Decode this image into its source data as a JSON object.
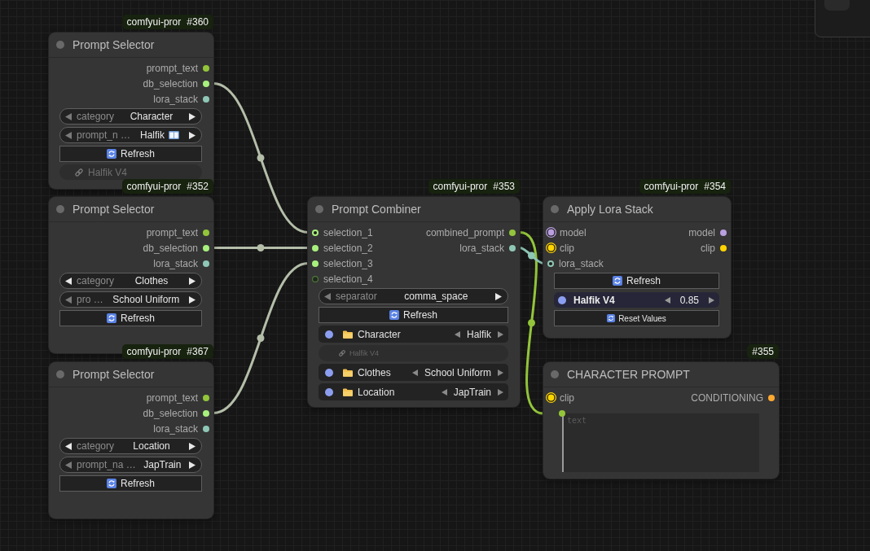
{
  "nodes": [
    {
      "badge": {
        "source": "comfyui-pror",
        "number": "#360"
      },
      "title": "Prompt Selector",
      "outputs": [
        {
          "name": "prompt_text",
          "color": "#93c53a",
          "kind": "dot"
        },
        {
          "name": "db_selection",
          "color": "#a8f07e",
          "kind": "dot"
        },
        {
          "name": "lora_stack",
          "color": "#8fc7b6",
          "kind": "dot"
        }
      ],
      "widgets": [
        {
          "kind": "combo",
          "label": "category",
          "value": "Character",
          "prev_disabled": true,
          "annotated": false
        },
        {
          "kind": "combo",
          "label": "prompt_n …",
          "value": "Halfik",
          "prev_disabled": true,
          "annotated": true
        },
        {
          "kind": "button",
          "label": "Refresh"
        },
        {
          "kind": "chip",
          "label": "Halfik V4"
        }
      ]
    },
    {
      "badge": {
        "source": "comfyui-pror",
        "number": "#352"
      },
      "title": "Prompt Selector",
      "outputs": [
        {
          "name": "prompt_text",
          "color": "#93c53a",
          "kind": "dot"
        },
        {
          "name": "db_selection",
          "color": "#a8f07e",
          "kind": "dot"
        },
        {
          "name": "lora_stack",
          "color": "#8fc7b6",
          "kind": "dot"
        }
      ],
      "widgets": [
        {
          "kind": "combo",
          "label": "category",
          "value": "Clothes",
          "prev_disabled": false,
          "annotated": false
        },
        {
          "kind": "combo",
          "label": "pro …",
          "value": "School Uniform",
          "prev_disabled": true,
          "annotated": false
        },
        {
          "kind": "button",
          "label": "Refresh"
        }
      ]
    },
    {
      "badge": {
        "source": "comfyui-pror",
        "number": "#367"
      },
      "title": "Prompt Selector",
      "outputs": [
        {
          "name": "prompt_text",
          "color": "#93c53a",
          "kind": "dot"
        },
        {
          "name": "db_selection",
          "color": "#a8f07e",
          "kind": "dot"
        },
        {
          "name": "lora_stack",
          "color": "#8fc7b6",
          "kind": "dot"
        }
      ],
      "widgets": [
        {
          "kind": "combo",
          "label": "category",
          "value": "Location",
          "prev_disabled": false,
          "annotated": false
        },
        {
          "kind": "combo",
          "label": "prompt_na …",
          "value": "JapTrain",
          "prev_disabled": true,
          "annotated": false
        },
        {
          "kind": "button",
          "label": "Refresh"
        }
      ]
    },
    {
      "badge": {
        "source": "comfyui-pror",
        "number": "#353"
      },
      "title": "Prompt Combiner",
      "inputs": [
        {
          "name": "selection_1",
          "color": "#a8f07e",
          "kind": "ring"
        },
        {
          "name": "selection_2",
          "color": "#a8f07e",
          "kind": "dot"
        },
        {
          "name": "selection_3",
          "color": "#a8f07e",
          "kind": "dot"
        },
        {
          "name": "selection_4",
          "color": "#4d7a3a",
          "kind": "faint"
        }
      ],
      "outputs": [
        {
          "name": "combined_prompt",
          "color": "#93c53a",
          "kind": "dot"
        },
        {
          "name": "lora_stack",
          "color": "#8fc7b6",
          "kind": "dot"
        }
      ],
      "widgets": [
        {
          "kind": "combo",
          "label": "separator",
          "value": "comma_space",
          "prev_disabled": true,
          "annotated": false
        },
        {
          "kind": "button",
          "label": "Refresh"
        },
        {
          "kind": "entry",
          "label": "Character",
          "value": "Halfik",
          "enabled": true
        },
        {
          "kind": "note",
          "label": "Halfik V4"
        },
        {
          "kind": "entry",
          "label": "Clothes",
          "value": "School Uniform",
          "enabled": true
        },
        {
          "kind": "entry",
          "label": "Location",
          "value": "JapTrain",
          "enabled": true
        }
      ]
    },
    {
      "badge": {
        "source": "comfyui-pror",
        "number": "#354"
      },
      "title": "Apply Lora Stack",
      "inputs": [
        {
          "name": "model",
          "color": "#b9a0e0",
          "kind": "large"
        },
        {
          "name": "clip",
          "color": "#ffd500",
          "kind": "large"
        },
        {
          "name": "lora_stack",
          "color": "#8fc7b6",
          "kind": "ring"
        }
      ],
      "outputs": [
        {
          "name": "model",
          "color": "#b9a0e0",
          "kind": "dot"
        },
        {
          "name": "clip",
          "color": "#ffd500",
          "kind": "dot"
        }
      ],
      "widgets": [
        {
          "kind": "button",
          "label": "Refresh"
        },
        {
          "kind": "lora",
          "label": "Halfik V4",
          "value": "0.85",
          "enabled": true
        },
        {
          "kind": "smallbutton",
          "label": "Reset Values"
        }
      ]
    },
    {
      "badge": {
        "number": "#355"
      },
      "title": "CHARACTER PROMPT",
      "inputs": [
        {
          "name": "clip",
          "color": "#ffd500",
          "kind": "large"
        }
      ],
      "outputs": [
        {
          "name": "CONDITIONING",
          "color": "#ffa931",
          "kind": "dot"
        }
      ],
      "widgets": [
        {
          "kind": "textarea",
          "placeholder": "text",
          "color": "#93c53a"
        }
      ]
    }
  ]
}
